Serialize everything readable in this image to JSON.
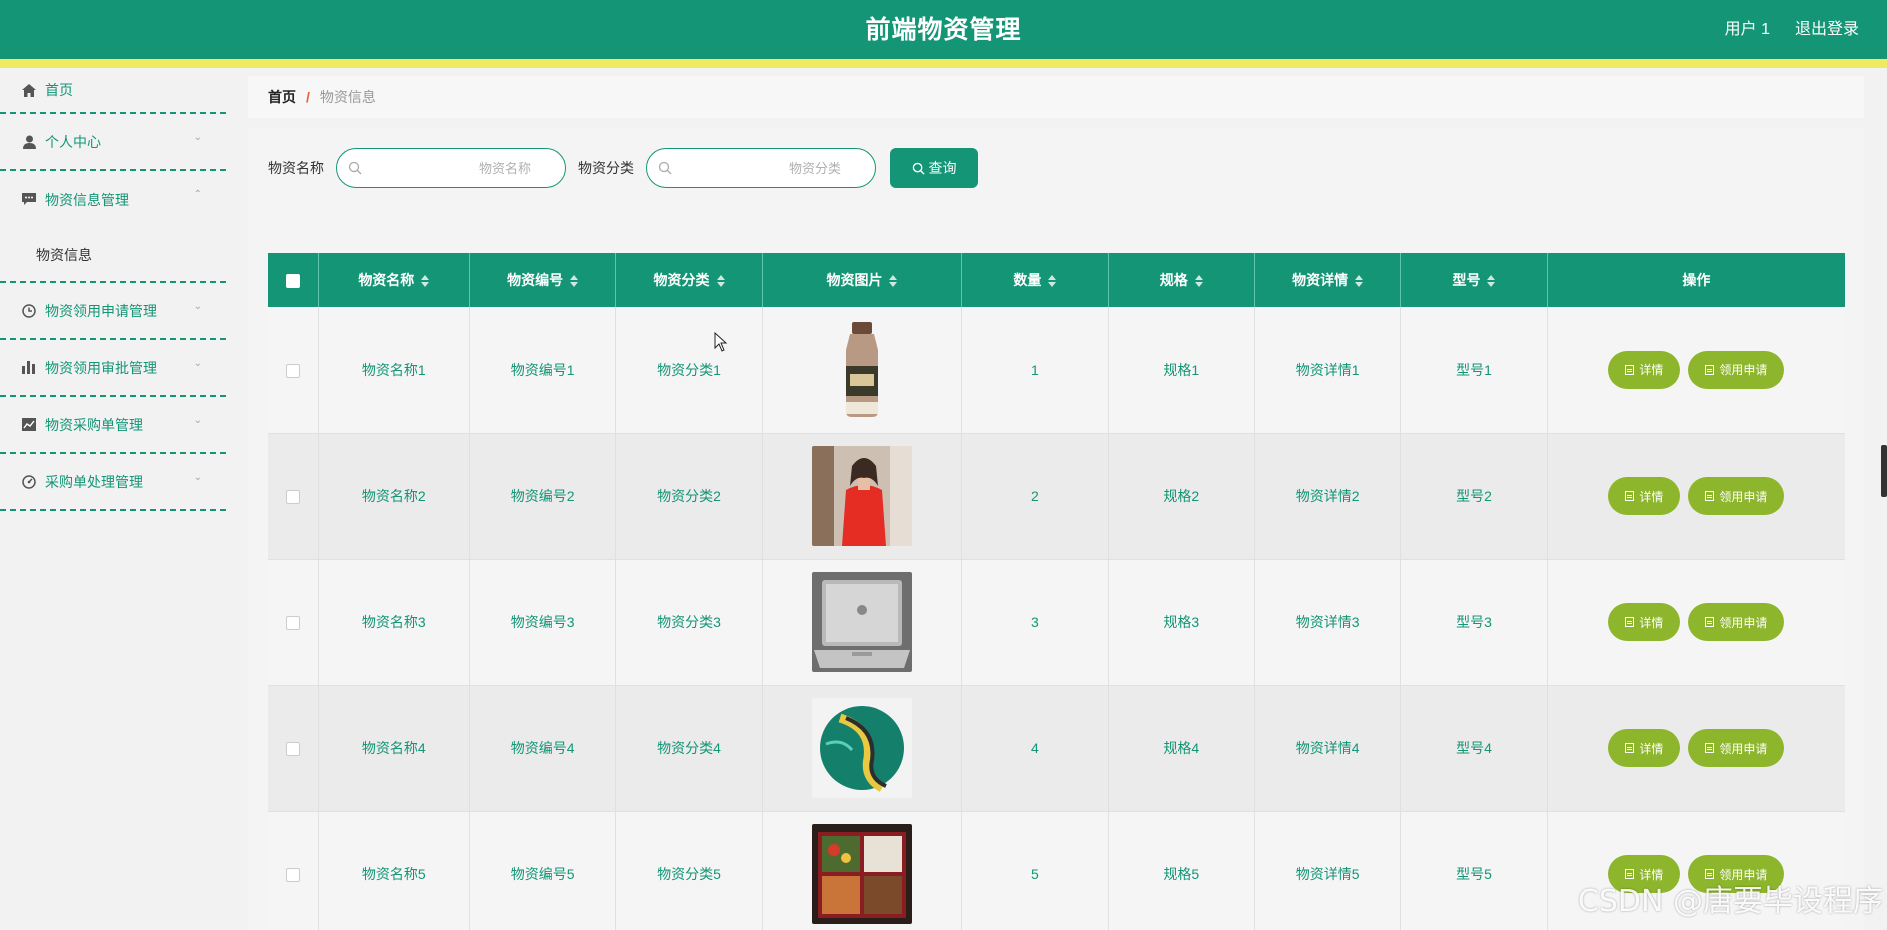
{
  "header": {
    "title": "前端物资管理",
    "user": "用户 1",
    "logout": "退出登录"
  },
  "sidebar": {
    "items": [
      {
        "label": "首页",
        "icon": "home-icon"
      },
      {
        "label": "个人中心",
        "icon": "user-icon"
      },
      {
        "label": "物资信息管理",
        "icon": "chat-icon",
        "expanded": true,
        "sub": [
          "物资信息"
        ]
      },
      {
        "label": "物资领用申请管理",
        "icon": "clock-icon"
      },
      {
        "label": "物资领用审批管理",
        "icon": "bar-chart-icon"
      },
      {
        "label": "物资采购单管理",
        "icon": "line-chart-icon"
      },
      {
        "label": "采购单处理管理",
        "icon": "gauge-icon"
      }
    ]
  },
  "breadcrumb": {
    "home": "首页",
    "separator": "/",
    "current": "物资信息"
  },
  "search": {
    "name_label": "物资名称",
    "name_placeholder": "物资名称",
    "category_label": "物资分类",
    "category_placeholder": "物资分类",
    "button": "查询"
  },
  "table": {
    "columns": [
      "物资名称",
      "物资编号",
      "物资分类",
      "物资图片",
      "数量",
      "规格",
      "物资详情",
      "型号",
      "操作"
    ],
    "rows": [
      {
        "name": "物资名称1",
        "code": "物资编号1",
        "category": "物资分类1",
        "image": "bottle-drink-image",
        "qty": "1",
        "spec": "规格1",
        "detail": "物资详情1",
        "model": "型号1"
      },
      {
        "name": "物资名称2",
        "code": "物资编号2",
        "category": "物资分类2",
        "image": "woman-red-dress-image",
        "qty": "2",
        "spec": "规格2",
        "detail": "物资详情2",
        "model": "型号2"
      },
      {
        "name": "物资名称3",
        "code": "物资编号3",
        "category": "物资分类3",
        "image": "laptop-image",
        "qty": "3",
        "spec": "规格3",
        "detail": "物资详情3",
        "model": "型号3"
      },
      {
        "name": "物资名称4",
        "code": "物资编号4",
        "category": "物资分类4",
        "image": "football-image",
        "qty": "4",
        "spec": "规格4",
        "detail": "物资详情4",
        "model": "型号4"
      },
      {
        "name": "物资名称5",
        "code": "物资编号5",
        "category": "物资分类5",
        "image": "food-box-image",
        "qty": "5",
        "spec": "规格5",
        "detail": "物资详情5",
        "model": "型号5"
      }
    ],
    "actions": {
      "detail": "详情",
      "apply": "领用申请"
    }
  },
  "watermark": "CSDN @唐要毕设程序",
  "colors": {
    "primary": "#139576",
    "stripe": "#f0ea62",
    "action": "#8db62c"
  }
}
